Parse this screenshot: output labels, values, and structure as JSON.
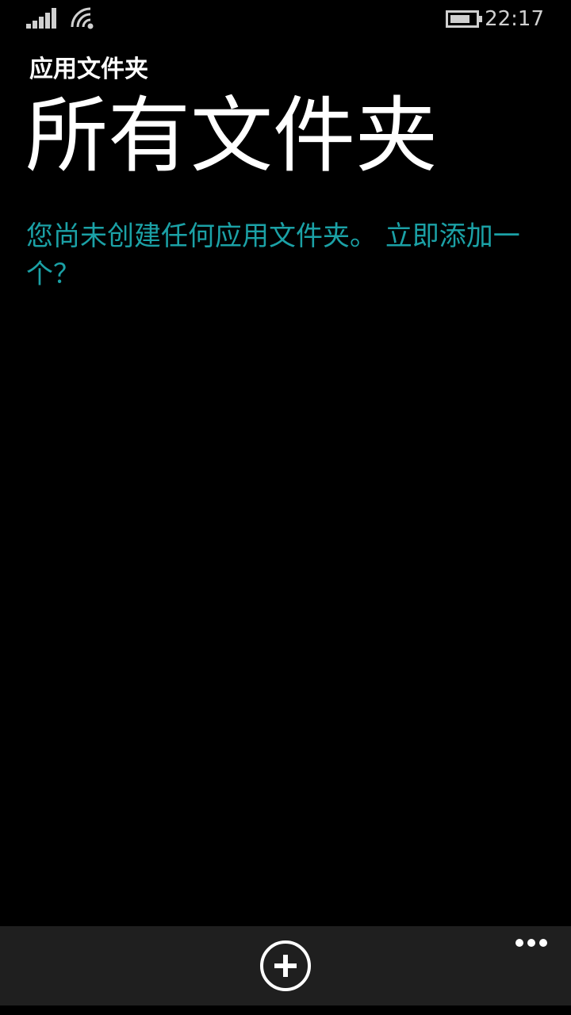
{
  "status_bar": {
    "time": "22:17",
    "icons": [
      "signal-icon",
      "wifi-icon",
      "battery-icon"
    ]
  },
  "header": {
    "app_title": "应用文件夹",
    "page_title": "所有文件夹"
  },
  "content": {
    "empty_message": "您尚未创建任何应用文件夹。",
    "add_link": "立即添加一个？"
  },
  "app_bar": {
    "icons": [
      "add-icon",
      "more-icon"
    ]
  },
  "colors": {
    "accent": "#1ba1a6",
    "background": "#000000",
    "app_bar": "#1f1f1f"
  }
}
